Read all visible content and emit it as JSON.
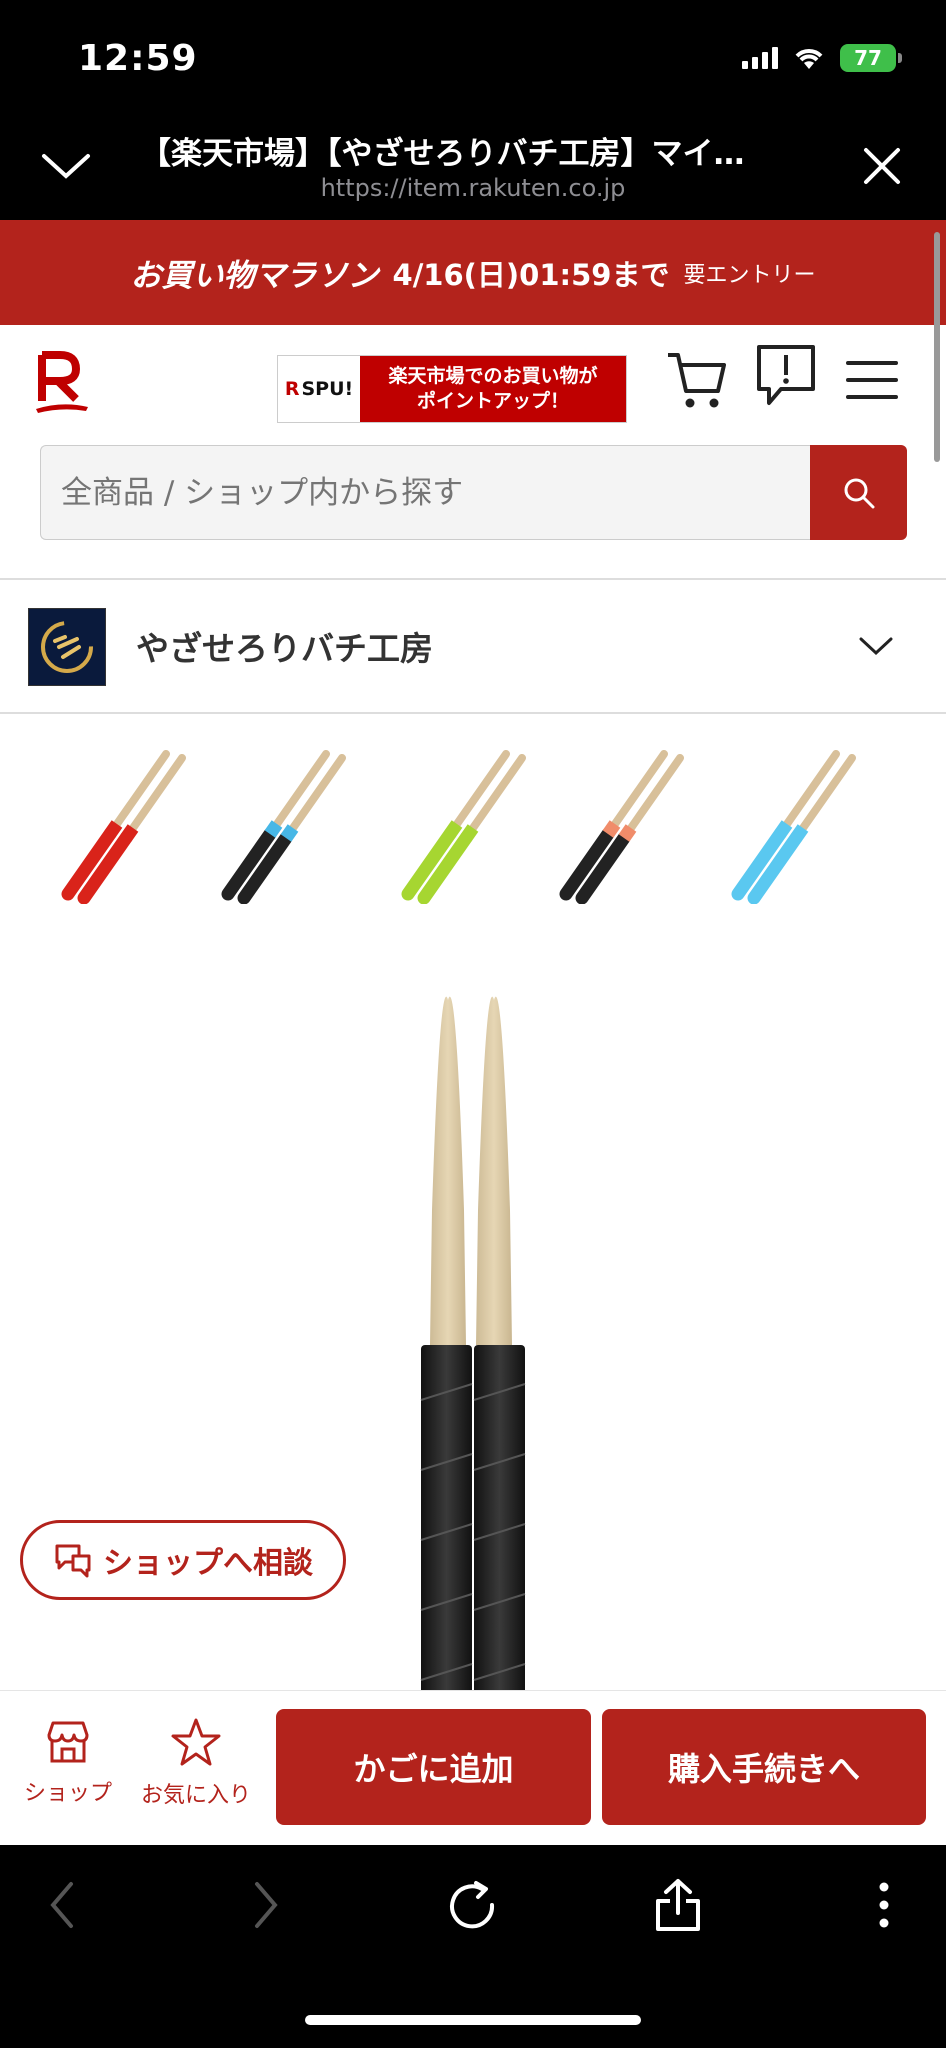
{
  "status_bar": {
    "time": "12:59",
    "battery": "77"
  },
  "browser": {
    "title": "【楽天市場】【やざせろりバチ工房】マイ…",
    "url": "https://item.rakuten.co.jp"
  },
  "campaign": {
    "name": "お買い物マラソン",
    "date": "4/16(日)01:59まで",
    "entry": "要エントリー"
  },
  "header": {
    "spu_label": "SPU!",
    "spu_r": "R",
    "spu_line1": "楽天市場でのお買い物が",
    "spu_line2": "ポイントアップ！"
  },
  "search": {
    "placeholder": "全商品 / ショップ内から探す"
  },
  "shop": {
    "name": "やざせろりバチ工房"
  },
  "variants": [
    {
      "grip_color": "#d9231a",
      "band_color": "#d9231a"
    },
    {
      "grip_color": "#222222",
      "band_color": "#47b7e6"
    },
    {
      "grip_color": "#a6d631",
      "band_color": "#a6d631"
    },
    {
      "grip_color": "#222222",
      "band_color": "#f08c6a"
    },
    {
      "grip_color": "#5ac8f0",
      "band_color": "#5ac8f0"
    }
  ],
  "consult": {
    "label": "ショップへ相談"
  },
  "actions": {
    "shop_label": "ショップ",
    "favorite_label": "お気に入り",
    "add_to_cart": "かごに追加",
    "checkout": "購入手続きへ"
  },
  "colors": {
    "brand_red": "#b3231c",
    "black": "#000000"
  }
}
